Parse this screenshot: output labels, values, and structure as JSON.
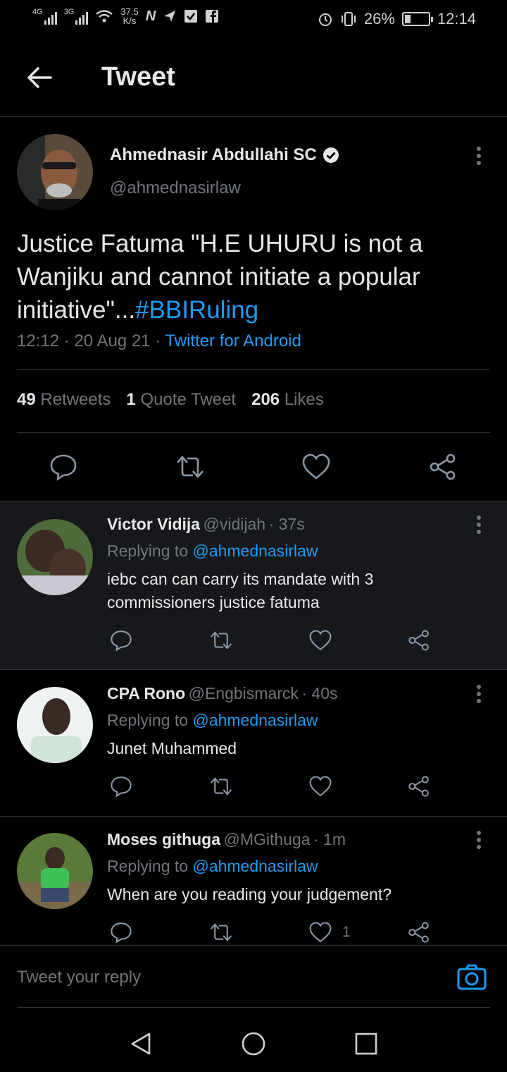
{
  "status_bar": {
    "net1": "4G",
    "net2": "3G",
    "speed_value": "37.5",
    "speed_unit": "K/s",
    "battery": "26%",
    "time": "12:14",
    "battery_level": 0.26
  },
  "header": {
    "title": "Tweet"
  },
  "tweet": {
    "author_name": "Ahmednasir Abdullahi SC",
    "author_handle": "@ahmednasirlaw",
    "text": "Justice Fatuma \"H.E UHURU is not a Wanjiku and cannot initiate a popular initiative\"...",
    "hashtag": "#BBIRuling",
    "time": "12:12",
    "date": "20 Aug 21",
    "sep": "·",
    "source": "Twitter for Android",
    "retweets_count": "49",
    "retweets_label": "Retweets",
    "quotes_count": "1",
    "quotes_label": "Quote Tweet",
    "likes_count": "206",
    "likes_label": "Likes"
  },
  "replies": [
    {
      "name": "Victor Vidija",
      "handle": "@vidijah",
      "time": "· 37s",
      "replying_label": "Replying to",
      "replying_to": "@ahmednasirlaw",
      "text": "iebc can can carry its mandate with 3 commissioners  justice fatuma",
      "like_count": ""
    },
    {
      "name": "CPA Rono",
      "handle": "@Engbismarck",
      "time": "· 40s",
      "replying_label": "Replying to",
      "replying_to": "@ahmednasirlaw",
      "text": "Junet Muhammed",
      "like_count": ""
    },
    {
      "name": "Moses githuga",
      "handle": "@MGithuga",
      "time": "· 1m",
      "replying_label": "Replying to",
      "replying_to": "@ahmednasirlaw",
      "text": "When are you reading your judgement?",
      "like_count": "1"
    }
  ],
  "reply_box": {
    "placeholder": "Tweet your reply"
  },
  "colors": {
    "link": "#1d9bf0",
    "background": "#000000",
    "muted": "#71767b"
  }
}
